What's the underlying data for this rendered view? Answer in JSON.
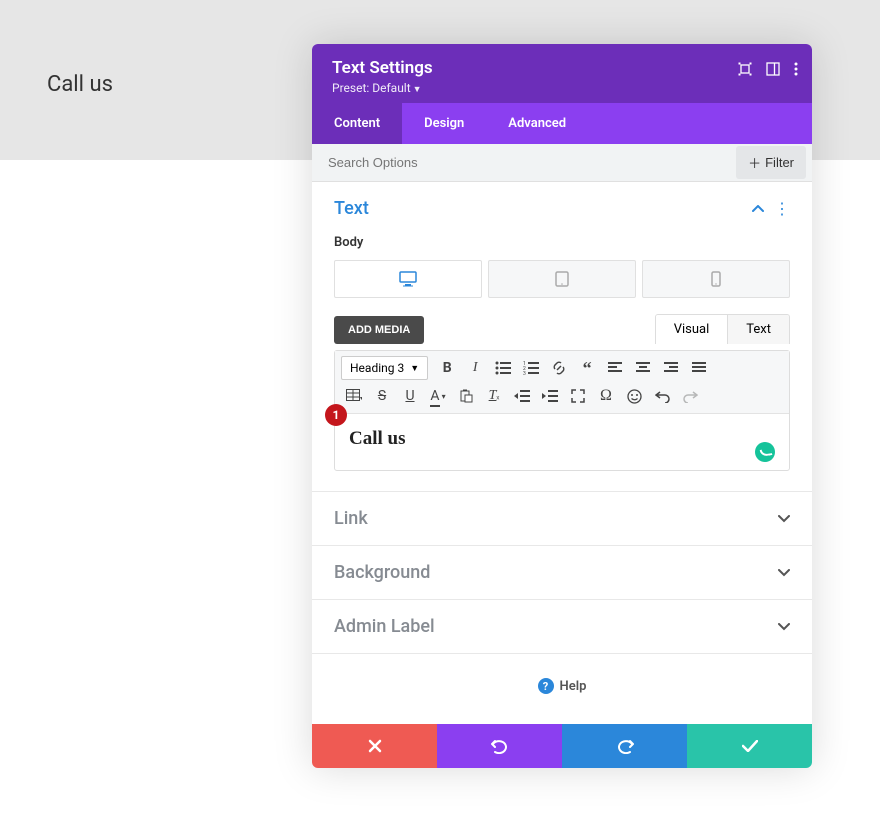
{
  "background": {
    "text": "Call us"
  },
  "header": {
    "title": "Text Settings",
    "preset_label": "Preset: Default"
  },
  "tabs": {
    "content": "Content",
    "design": "Design",
    "advanced": "Advanced"
  },
  "search": {
    "placeholder": "Search Options",
    "filter_label": "Filter"
  },
  "sections": {
    "text": {
      "title": "Text"
    },
    "body_label": "Body",
    "link": "Link",
    "background": "Background",
    "admin": "Admin Label"
  },
  "editor": {
    "add_media": "ADD MEDIA",
    "tabs": {
      "visual": "Visual",
      "text": "Text"
    },
    "format_select": "Heading 3",
    "content": "Call us"
  },
  "annotation": {
    "one": "1"
  },
  "help": {
    "label": "Help"
  }
}
